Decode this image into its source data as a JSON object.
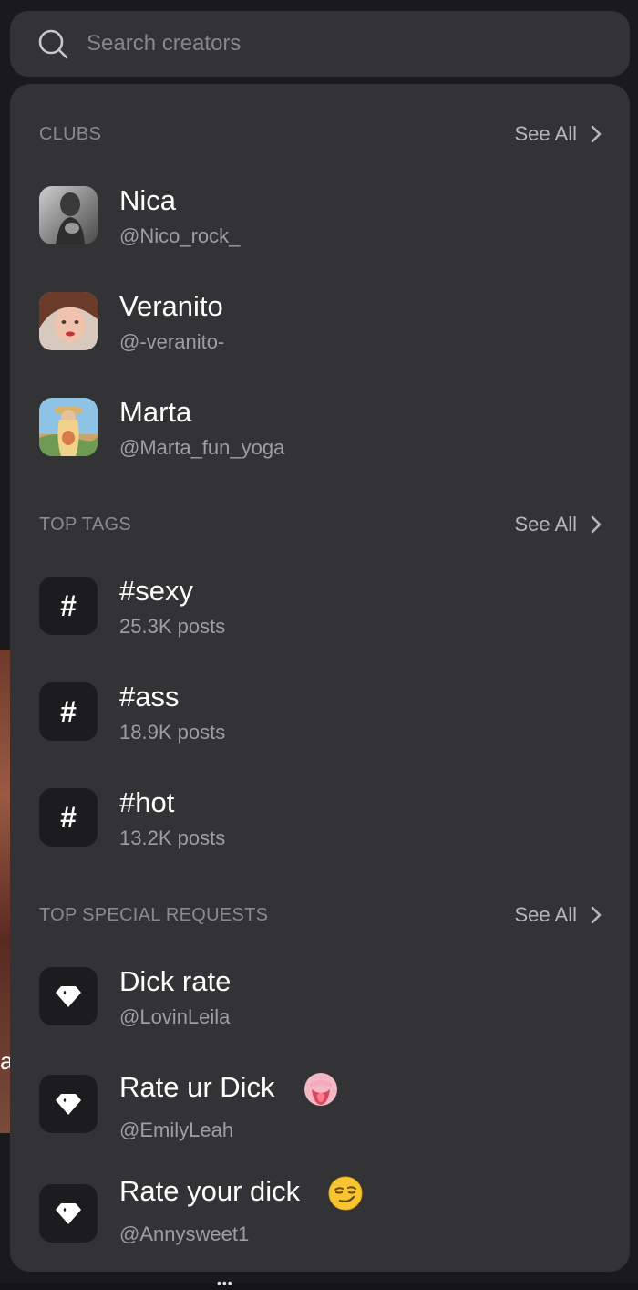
{
  "search": {
    "placeholder": "Search creators"
  },
  "clubs": {
    "title": "CLUBS",
    "see_all": "See All",
    "items": [
      {
        "name": "Nica",
        "handle": "@Nico_rock_"
      },
      {
        "name": "Veranito",
        "handle": "@-veranito-"
      },
      {
        "name": "Marta",
        "handle": "@Marta_fun_yoga"
      }
    ]
  },
  "tags": {
    "title": "TOP TAGS",
    "see_all": "See All",
    "items": [
      {
        "glyph": "#",
        "name": "#sexy",
        "count": "25.3K posts"
      },
      {
        "glyph": "#",
        "name": "#ass",
        "count": "18.9K posts"
      },
      {
        "glyph": "#",
        "name": "#hot",
        "count": "13.2K posts"
      }
    ]
  },
  "requests": {
    "title": "TOP SPECIAL REQUESTS",
    "see_all": "See All",
    "items": [
      {
        "name": "Dick rate",
        "handle": "@LovinLeila",
        "emoji": ""
      },
      {
        "name": "Rate ur Dick",
        "handle": "@EmilyLeah",
        "emoji": "tongue-out-face-emoji"
      },
      {
        "name": "Rate your dick",
        "handle": "@Annysweet1",
        "emoji": "smirking-face-emoji"
      }
    ]
  },
  "background": {
    "partial_letter": "a",
    "dots": "•••"
  },
  "colors": {
    "panel": "#333335",
    "page": "#1a1a1c",
    "tile": "#1c1c1e",
    "muted_text": "#9e9ea3",
    "section_title": "#8a8a8f"
  }
}
